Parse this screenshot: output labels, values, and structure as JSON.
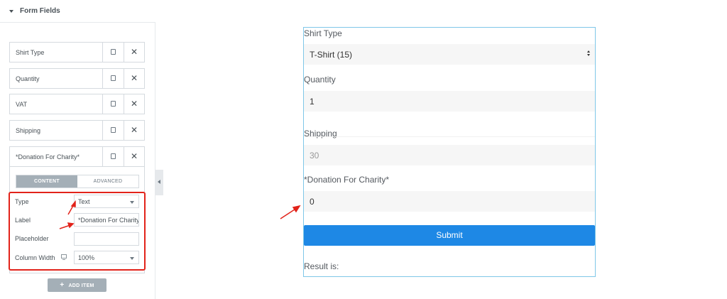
{
  "panel": {
    "section_title": "Form Fields",
    "items": [
      {
        "label": "Shirt Type"
      },
      {
        "label": "Quantity"
      },
      {
        "label": "VAT"
      },
      {
        "label": "Shipping"
      },
      {
        "label": "*Donation For Charity*"
      }
    ],
    "tabs": {
      "content": "CONTENT",
      "advanced": "ADVANCED"
    },
    "controls": {
      "type_label": "Type",
      "type_value": "Text",
      "label_label": "Label",
      "label_value": "*Donation For Charity*",
      "placeholder_label": "Placeholder",
      "placeholder_value": "",
      "column_width_label": "Column Width",
      "column_width_value": "100%"
    },
    "add_item": "ADD ITEM"
  },
  "form": {
    "shirt_type_label": "Shirt Type",
    "shirt_type_value": "T-Shirt (15)",
    "quantity_label": "Quantity",
    "quantity_value": "1",
    "shipping_label": "Shipping",
    "shipping_value": "30",
    "donation_label": "*Donation For Charity*",
    "donation_value": "0",
    "submit": "Submit",
    "result": "Result is:"
  },
  "colors": {
    "highlight": "#e2231a",
    "submit_bg": "#1e88e5",
    "preview_border": "#7fc7e8"
  }
}
